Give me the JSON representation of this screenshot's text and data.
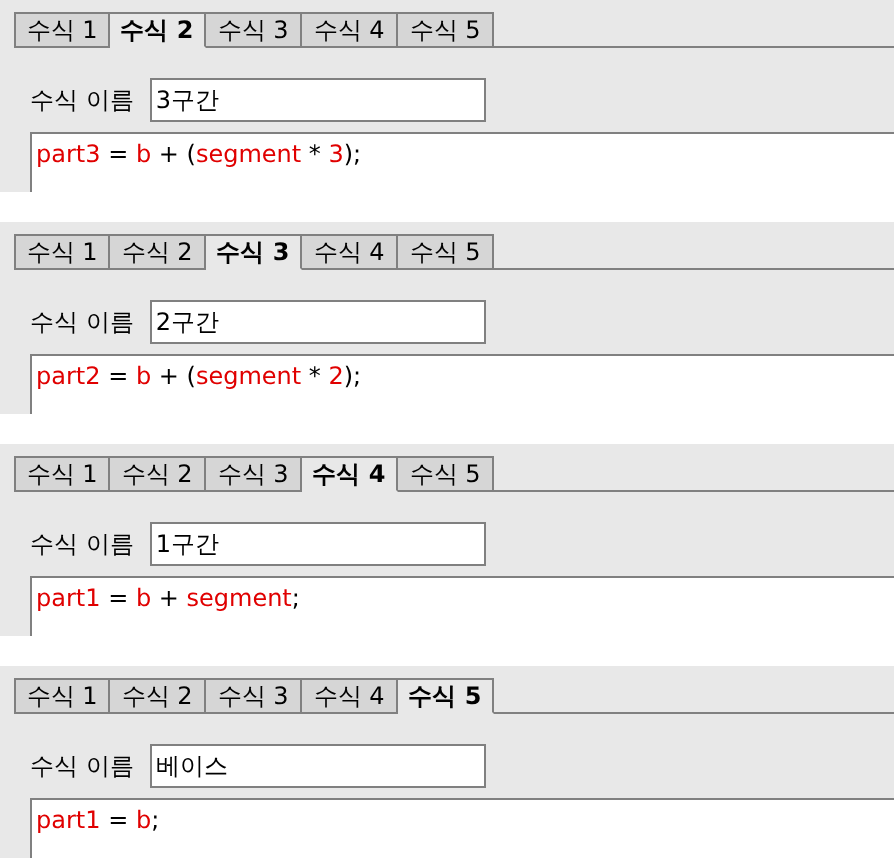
{
  "panels": [
    {
      "tabs": [
        {
          "label": "수식 1",
          "selected": false
        },
        {
          "label": "수식 2",
          "selected": true
        },
        {
          "label": "수식 3",
          "selected": false
        },
        {
          "label": "수식 4",
          "selected": false
        },
        {
          "label": "수식 5",
          "selected": false
        }
      ],
      "name_label": "수식 이름",
      "name_value": "3구간",
      "code": [
        {
          "kind": "ident",
          "text": "part3"
        },
        {
          "kind": "op",
          "text": " = "
        },
        {
          "kind": "ident",
          "text": "b"
        },
        {
          "kind": "op",
          "text": " + ("
        },
        {
          "kind": "ident",
          "text": "segment"
        },
        {
          "kind": "op",
          "text": " * "
        },
        {
          "kind": "ident",
          "text": "3"
        },
        {
          "kind": "op",
          "text": ");"
        }
      ]
    },
    {
      "tabs": [
        {
          "label": "수식 1",
          "selected": false
        },
        {
          "label": "수식 2",
          "selected": false
        },
        {
          "label": "수식 3",
          "selected": true
        },
        {
          "label": "수식 4",
          "selected": false
        },
        {
          "label": "수식 5",
          "selected": false
        }
      ],
      "name_label": "수식 이름",
      "name_value": "2구간",
      "code": [
        {
          "kind": "ident",
          "text": "part2"
        },
        {
          "kind": "op",
          "text": " = "
        },
        {
          "kind": "ident",
          "text": "b"
        },
        {
          "kind": "op",
          "text": " + ("
        },
        {
          "kind": "ident",
          "text": "segment"
        },
        {
          "kind": "op",
          "text": " * "
        },
        {
          "kind": "ident",
          "text": "2"
        },
        {
          "kind": "op",
          "text": ");"
        }
      ]
    },
    {
      "tabs": [
        {
          "label": "수식 1",
          "selected": false
        },
        {
          "label": "수식 2",
          "selected": false
        },
        {
          "label": "수식 3",
          "selected": false
        },
        {
          "label": "수식 4",
          "selected": true
        },
        {
          "label": "수식 5",
          "selected": false
        }
      ],
      "name_label": "수식 이름",
      "name_value": "1구간",
      "code": [
        {
          "kind": "ident",
          "text": "part1"
        },
        {
          "kind": "op",
          "text": " = "
        },
        {
          "kind": "ident",
          "text": "b"
        },
        {
          "kind": "op",
          "text": " + "
        },
        {
          "kind": "ident",
          "text": "segment"
        },
        {
          "kind": "op",
          "text": ";"
        }
      ]
    },
    {
      "tabs": [
        {
          "label": "수식 1",
          "selected": false
        },
        {
          "label": "수식 2",
          "selected": false
        },
        {
          "label": "수식 3",
          "selected": false
        },
        {
          "label": "수식 4",
          "selected": false
        },
        {
          "label": "수식 5",
          "selected": true
        }
      ],
      "name_label": "수식 이름",
      "name_value": "베이스",
      "code": [
        {
          "kind": "ident",
          "text": "part1"
        },
        {
          "kind": "op",
          "text": " = "
        },
        {
          "kind": "ident",
          "text": "b"
        },
        {
          "kind": "op",
          "text": ";"
        }
      ]
    }
  ]
}
